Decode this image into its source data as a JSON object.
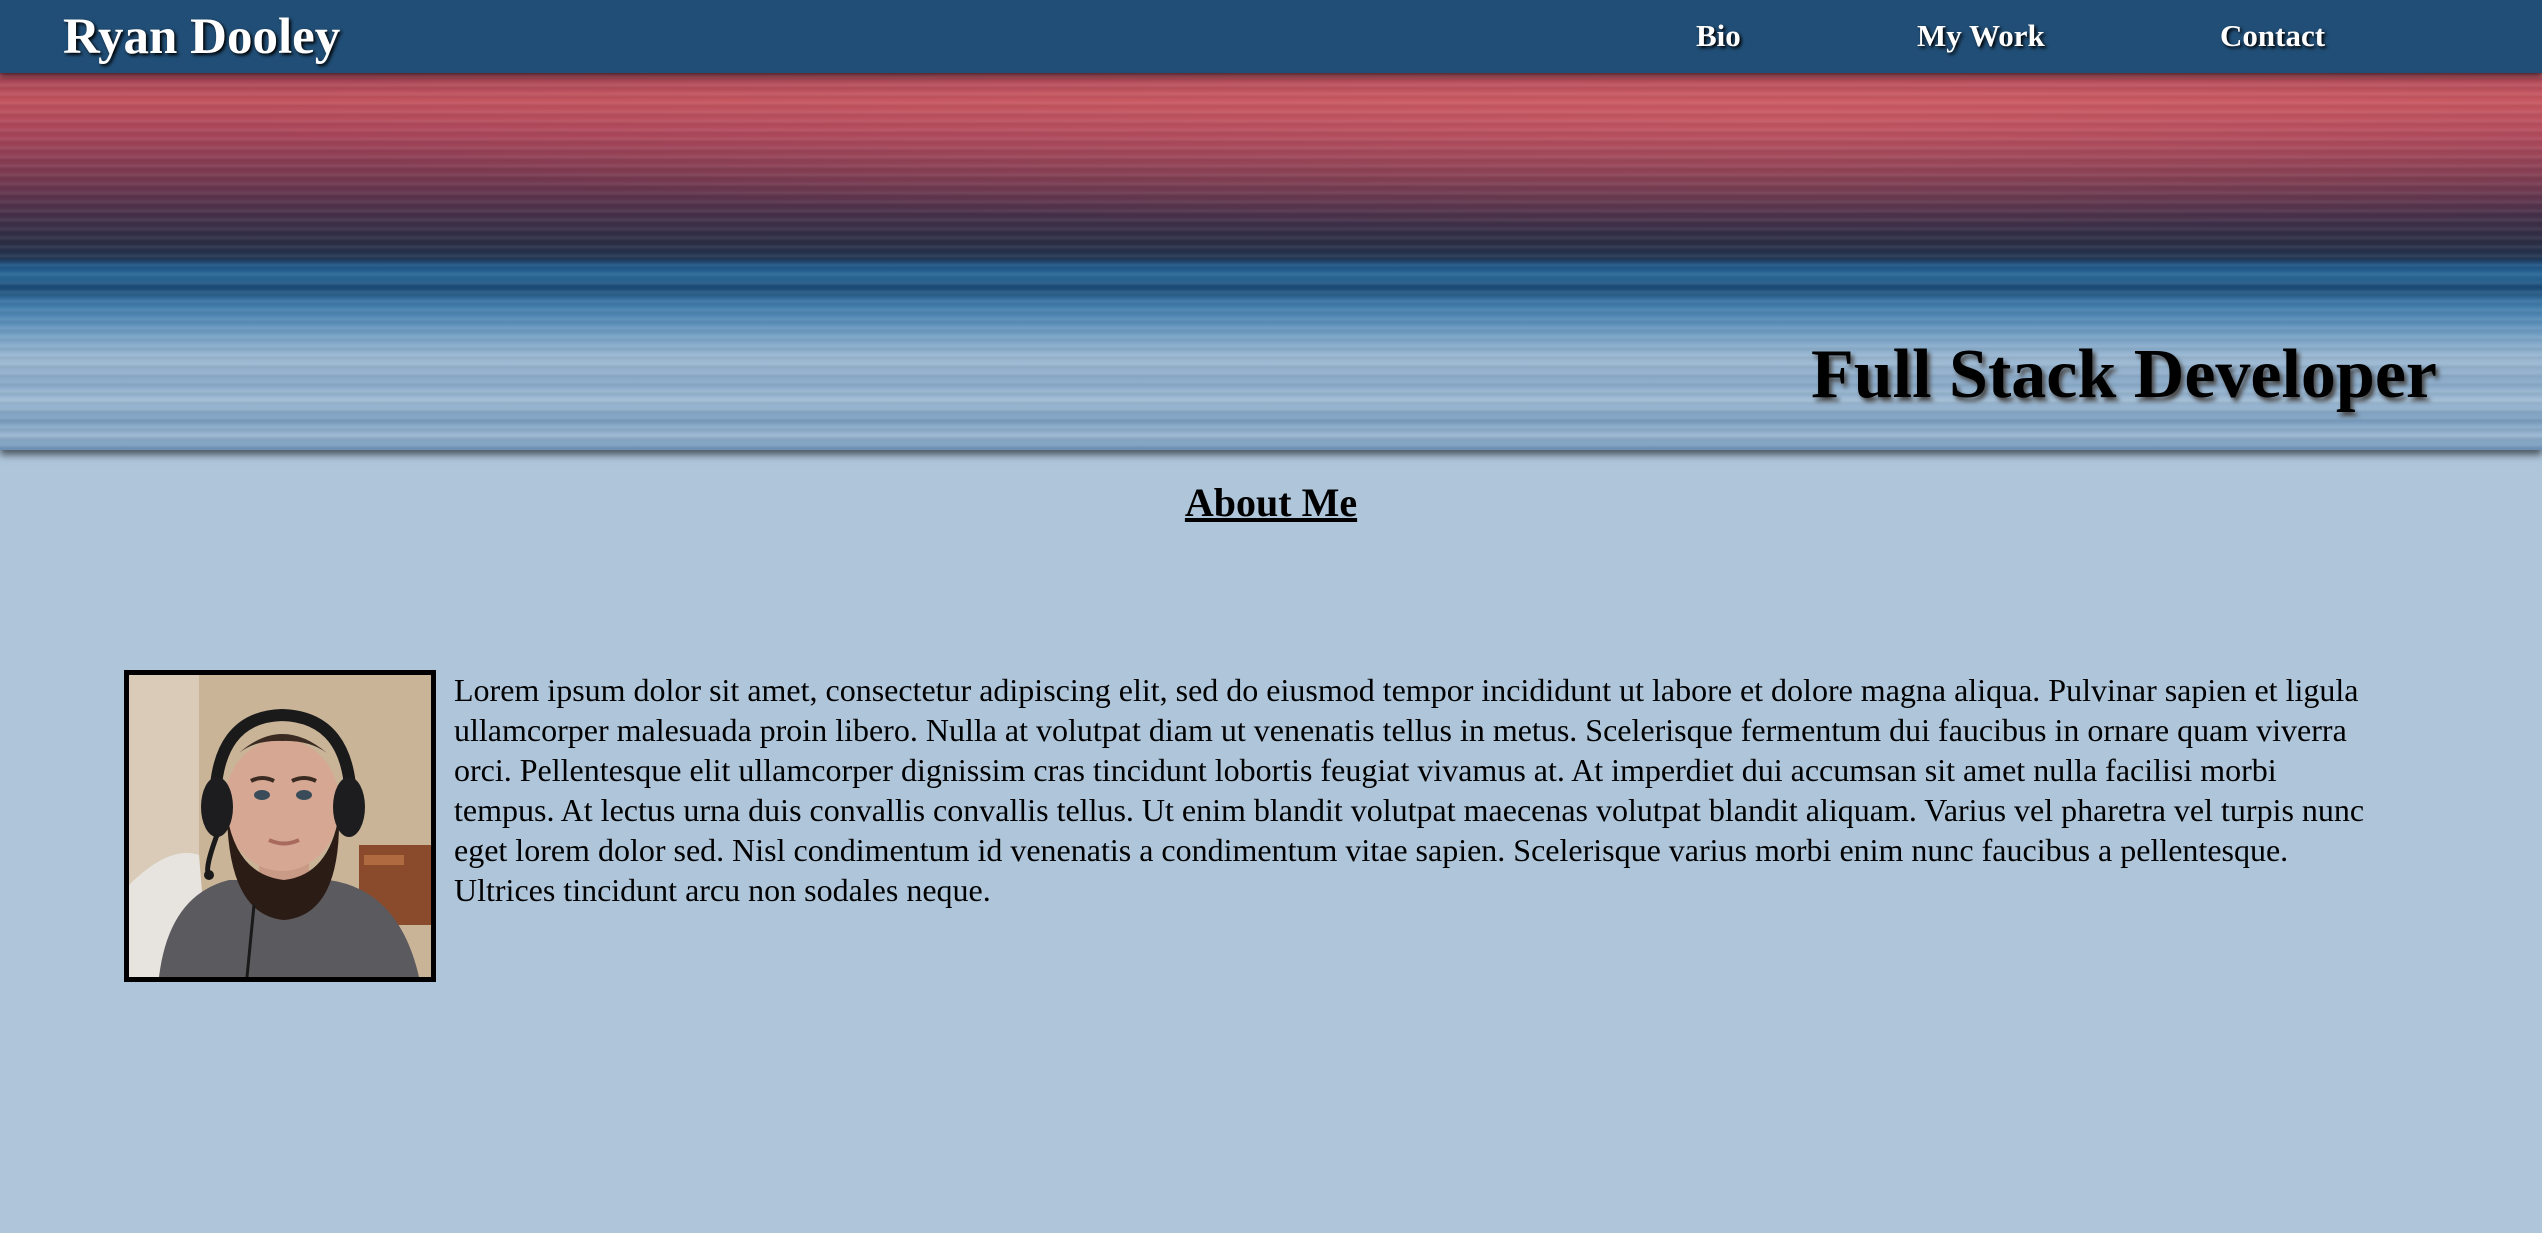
{
  "header": {
    "brand": "Ryan Dooley",
    "nav": [
      {
        "label": "Bio"
      },
      {
        "label": "My Work"
      },
      {
        "label": "Contact"
      }
    ]
  },
  "hero": {
    "title": "Full Stack Developer"
  },
  "about": {
    "heading": "About Me",
    "photo_icon": "profile-photo",
    "paragraph": "Lorem ipsum dolor sit amet, consectetur adipiscing elit, sed do eiusmod tempor incididunt ut labore et dolore magna aliqua. Pulvinar sapien et ligula ullamcorper malesuada proin libero. Nulla at volutpat diam ut venenatis tellus in metus. Scelerisque fermentum dui faucibus in ornare quam viverra orci. Pellentesque elit ullamcorper dignissim cras tincidunt lobortis feugiat vivamus at. At imperdiet dui accumsan sit amet nulla facilisi morbi tempus. At lectus urna duis convallis convallis tellus. Ut enim blandit volutpat maecenas volutpat blandit aliquam. Varius vel pharetra vel turpis nunc eget lorem dolor sed. Nisl condimentum id venenatis a condimentum vitae sapien. Scelerisque varius morbi enim nunc faucibus a pellentesque. Ultrices tincidunt arcu non sodales neque."
  },
  "colors": {
    "navbar": "#214e76",
    "page_background": "#aec5da",
    "nav_text": "#ffffff",
    "heading_text": "#000000"
  }
}
